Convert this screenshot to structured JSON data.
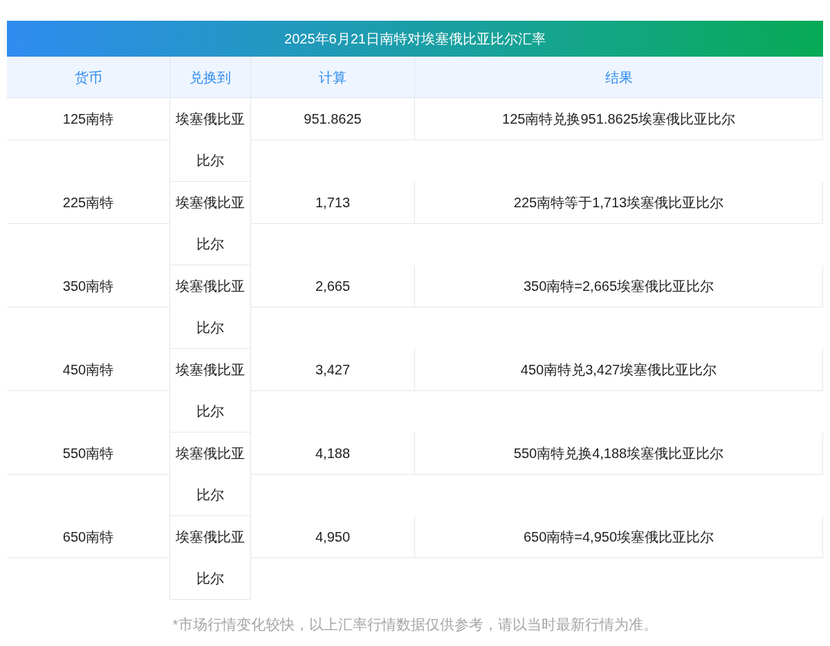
{
  "title": "2025年6月21日南特对埃塞俄比亚比尔汇率",
  "columns": [
    "货币",
    "兑换到",
    "计算",
    "结果"
  ],
  "rows": [
    {
      "currency": "125南特",
      "target": "埃塞俄比亚比尔",
      "amount": "951.8625",
      "result": "125南特兑换951.8625埃塞俄比亚比尔"
    },
    {
      "currency": "225南特",
      "target": "埃塞俄比亚比尔",
      "amount": "1,713",
      "result": "225南特等于1,713埃塞俄比亚比尔"
    },
    {
      "currency": "350南特",
      "target": "埃塞俄比亚比尔",
      "amount": "2,665",
      "result": "350南特=2,665埃塞俄比亚比尔"
    },
    {
      "currency": "450南特",
      "target": "埃塞俄比亚比尔",
      "amount": "3,427",
      "result": "450南特兑3,427埃塞俄比亚比尔"
    },
    {
      "currency": "550南特",
      "target": "埃塞俄比亚比尔",
      "amount": "4,188",
      "result": "550南特兑换4,188埃塞俄比亚比尔"
    },
    {
      "currency": "650南特",
      "target": "埃塞俄比亚比尔",
      "amount": "4,950",
      "result": "650南特=4,950埃塞俄比亚比尔"
    }
  ],
  "footnote": "*市场行情变化较快，以上汇率行情数据仅供参考，请以当时最新行情为准。"
}
